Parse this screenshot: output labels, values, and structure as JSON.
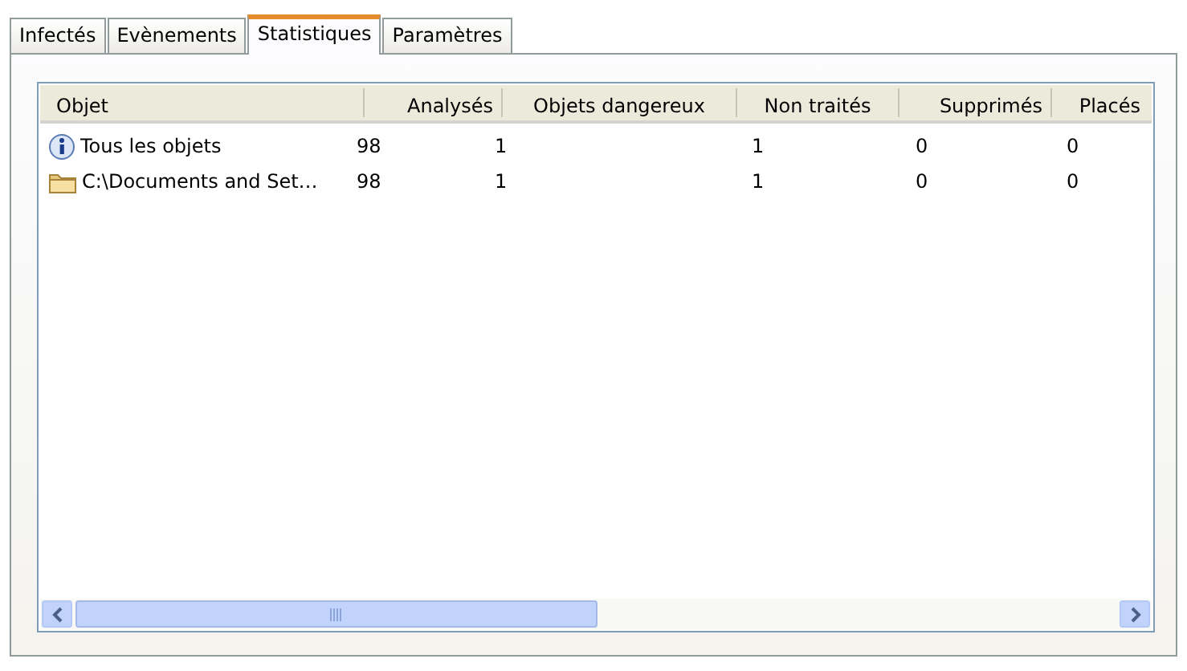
{
  "tabs": [
    {
      "label": "Infectés",
      "selected": false
    },
    {
      "label": "Evènements",
      "selected": false
    },
    {
      "label": "Statistiques",
      "selected": true
    },
    {
      "label": "Paramètres",
      "selected": false
    }
  ],
  "table": {
    "columns": [
      "Objet",
      "Analysés",
      "Objets dangereux",
      "Non traités",
      "Supprimés",
      "Placés"
    ],
    "rows": [
      {
        "kind": "info",
        "cells": [
          "Tous les objets",
          "98",
          "1",
          "1",
          "0",
          "0"
        ]
      },
      {
        "kind": "folder",
        "cells": [
          "C:\\Documents and Set…",
          "98",
          "1",
          "1",
          "0",
          "0"
        ]
      }
    ]
  }
}
